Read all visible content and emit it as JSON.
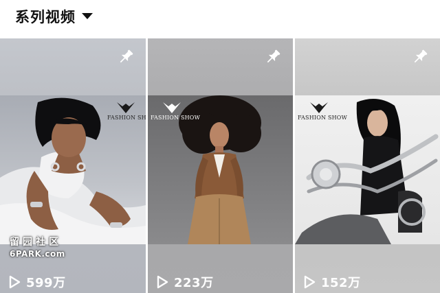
{
  "header": {
    "title": "系列视频",
    "dropdown_icon": "caret-down-icon"
  },
  "cards": [
    {
      "brand_text": "FASHION SHOW",
      "plays": "599万",
      "pin_icon": "pin-icon",
      "play_icon": "play-icon",
      "photo": "model in white crouching with silver jewelry"
    },
    {
      "brand_text": "FASHION SHOW",
      "plays": "223万",
      "pin_icon": "pin-icon",
      "play_icon": "play-icon",
      "photo": "model with voluminous hair in brown outfit"
    },
    {
      "brand_text": "FASHION SHOW",
      "plays": "152万",
      "pin_icon": "pin-icon",
      "play_icon": "play-icon",
      "photo": "model in black on chrome motorcycle"
    }
  ],
  "watermark": {
    "line1": "留园社区",
    "line2": "6PARK.com"
  },
  "colors": {
    "title": "#111111",
    "overlay_text": "#ffffff"
  }
}
